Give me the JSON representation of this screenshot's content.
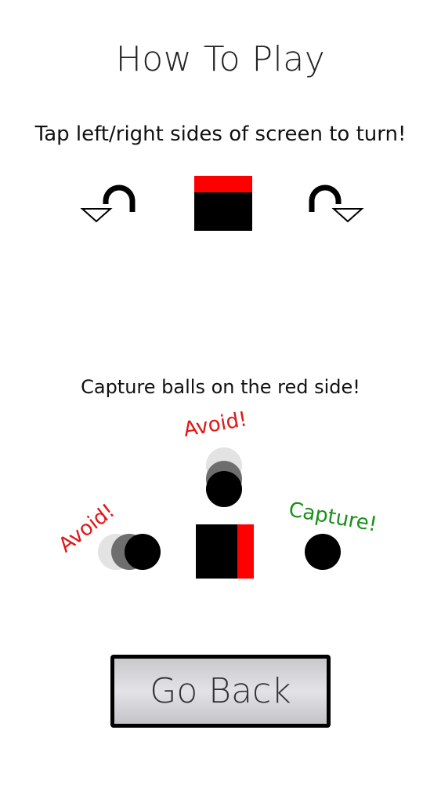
{
  "screen": {
    "title": "How To Play"
  },
  "instructions": {
    "turning": "Tap left/right sides of screen to turn!",
    "capture": "Capture balls on the red side!"
  },
  "icons": {
    "turn_left": "rotate-counterclockwise-arrow-icon",
    "turn_right": "rotate-clockwise-arrow-icon"
  },
  "labels": {
    "avoid_top": "Avoid!",
    "avoid_left": "Avoid!",
    "capture": "Capture!"
  },
  "colors": {
    "player": "#000000",
    "player_edge": "#ff0000",
    "avoid": "#e31515",
    "capture": "#1a8f1a"
  },
  "buttons": {
    "go_back": "Go Back"
  }
}
